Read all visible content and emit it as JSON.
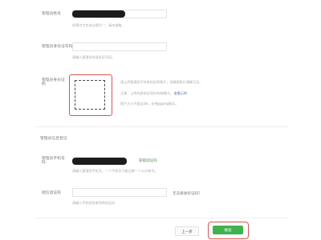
{
  "form": {
    "admin_name": {
      "label": "管理员姓名",
      "hint": "如果名字包含分隔号“·”，请勿省略。"
    },
    "admin_id": {
      "label": "管理员身份证号码",
      "hint": "请输入管理员的身份证号码。"
    },
    "admin_photo": {
      "label": "管理员身份证照",
      "desc_line1": "请上传管理员手持身份证的照片，须确保照片清晰可见。",
      "desc_line2": "注意：上传的身份证须在有效期内。",
      "desc_link": "查看示例",
      "desc_line3": "照片大小不超过2M，支持jpg/png格式。"
    },
    "section_title": "管理员信息登记",
    "admin_phone": {
      "label": "管理员手机号码",
      "link": "获取验证码",
      "hint": "请输入管理员手机号，一个手机号只能注册一个公众账号。"
    },
    "sms_code": {
      "label": "短信验证码",
      "link": "无法接收验证码？",
      "hint": "请输入手机短信收到的验证码"
    }
  },
  "buttons": {
    "prev": "上一步",
    "next": "继续"
  },
  "colors": {
    "primary_green": "#3fb24f",
    "highlight_red": "#d9534f",
    "mask_black": "#1c1c1c"
  }
}
